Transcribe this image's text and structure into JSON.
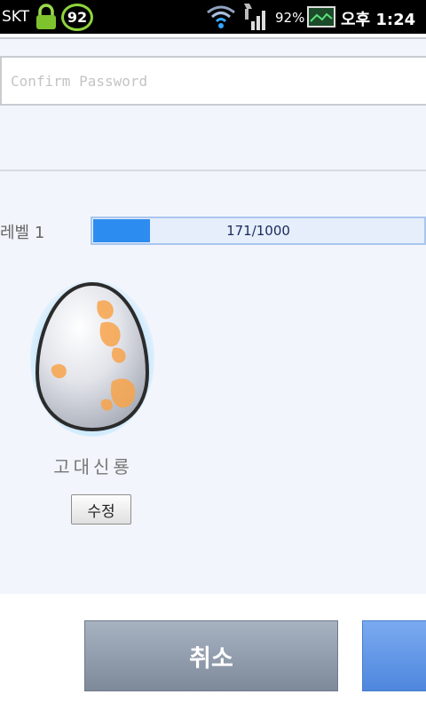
{
  "status_bar": {
    "carrier": "SKT",
    "notification_count": "92",
    "battery_percent": "92%",
    "time": "오후 1:24"
  },
  "form": {
    "confirm_password_placeholder": "Confirm Password",
    "confirm_password_value": ""
  },
  "level": {
    "label": "레벨 1",
    "progress_text": "171/1000",
    "current": 171,
    "max": 1000
  },
  "pet": {
    "name": "고대신룡",
    "edit_label": "수정"
  },
  "actions": {
    "cancel_label": "취소",
    "confirm_label": ""
  },
  "colors": {
    "progress_fill": "#2d8cf0",
    "progress_track": "#e6eefb",
    "cancel_button": "#8b96a6",
    "confirm_button": "#5b8fe0"
  }
}
